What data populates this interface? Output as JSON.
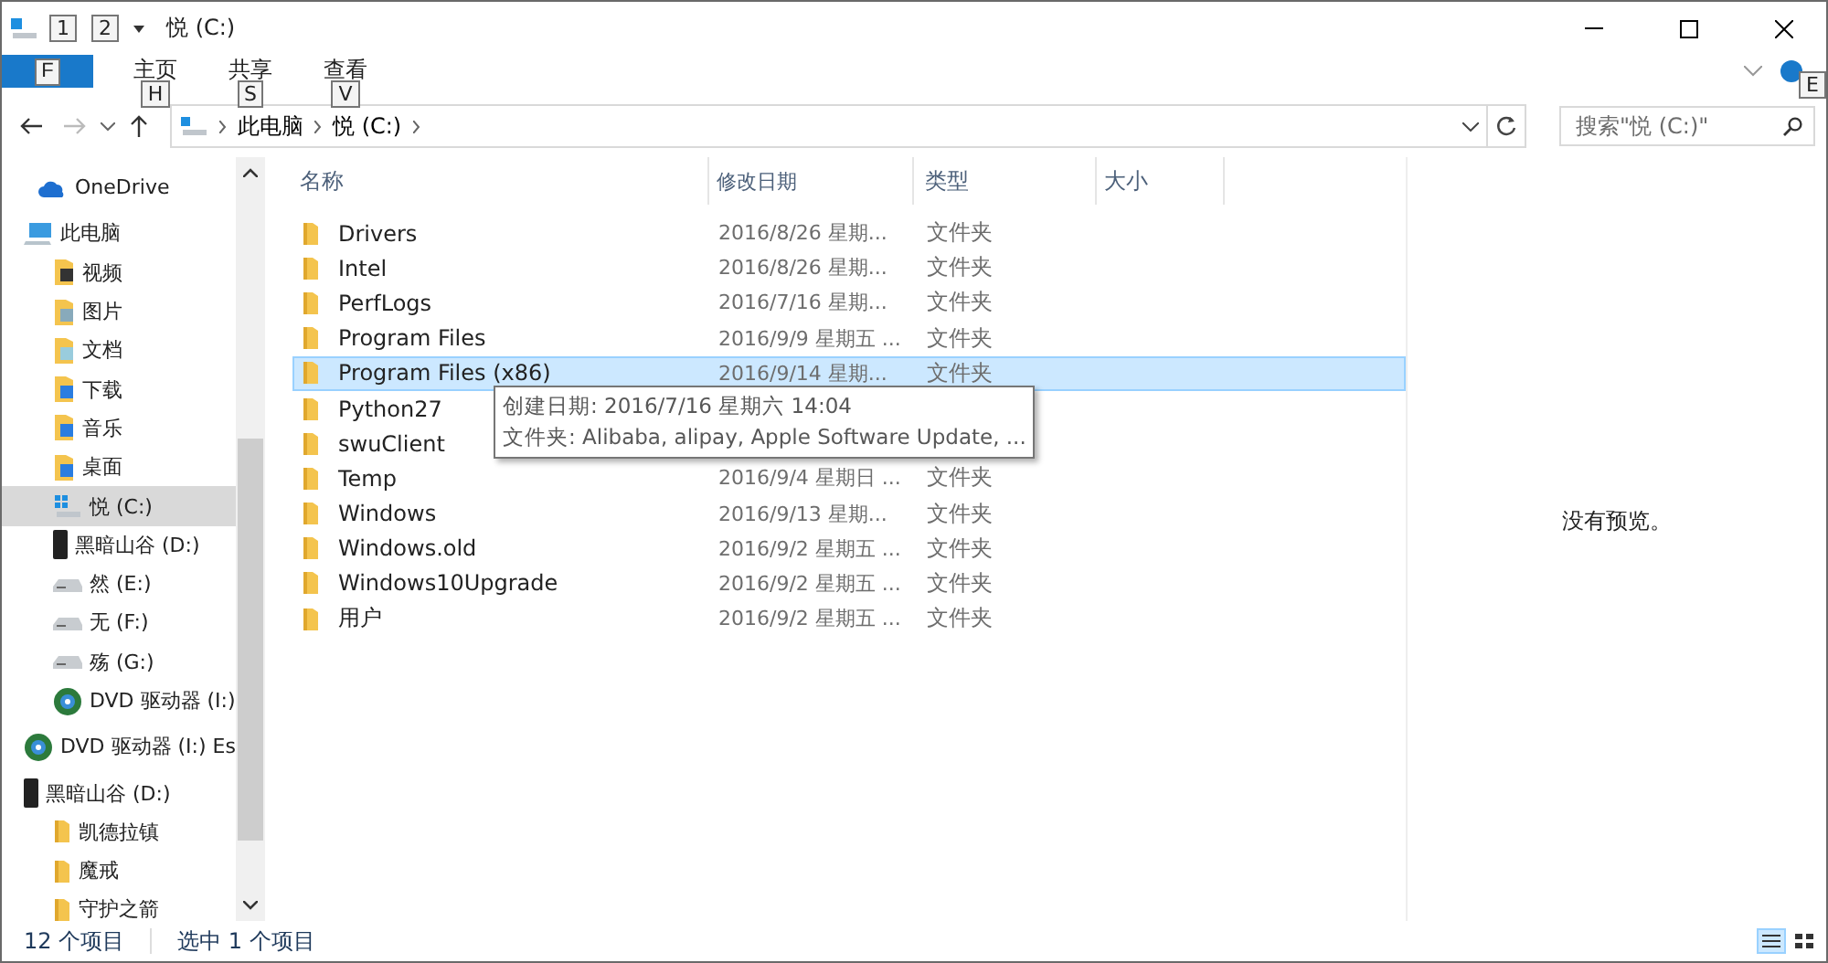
{
  "window": {
    "title": "悦 (C:)",
    "qat_keytips": [
      "1",
      "2"
    ]
  },
  "ribbon": {
    "file_keytip": "F",
    "tabs": [
      {
        "label": "主页",
        "keytip": "H"
      },
      {
        "label": "共享",
        "keytip": "S"
      },
      {
        "label": "查看",
        "keytip": "V"
      }
    ],
    "help_keytip": "E"
  },
  "address": {
    "crumbs": [
      "此电脑",
      "悦 (C:)"
    ],
    "search_placeholder": "搜索\"悦 (C:)\""
  },
  "sidebar": {
    "items": [
      {
        "label": "OneDrive",
        "kind": "cloud",
        "selected": false
      },
      {
        "label": "此电脑",
        "kind": "pc",
        "selected": false,
        "children": [
          {
            "label": "视频",
            "kind": "video",
            "selected": false
          },
          {
            "label": "图片",
            "kind": "pictures",
            "selected": false
          },
          {
            "label": "文档",
            "kind": "docs",
            "selected": false
          },
          {
            "label": "下载",
            "kind": "downloads",
            "selected": false
          },
          {
            "label": "音乐",
            "kind": "music",
            "selected": false
          },
          {
            "label": "桌面",
            "kind": "desktop",
            "selected": false
          },
          {
            "label": "悦 (C:)",
            "kind": "sysdrive",
            "selected": true
          },
          {
            "label": "黑暗山谷 (D:)",
            "kind": "phone",
            "selected": false
          },
          {
            "label": "然 (E:)",
            "kind": "drive",
            "selected": false
          },
          {
            "label": "无 (F:)",
            "kind": "drive",
            "selected": false
          },
          {
            "label": "殇 (G:)",
            "kind": "drive",
            "selected": false
          },
          {
            "label": "DVD 驱动器 (I:)",
            "kind": "dvd",
            "selected": false
          }
        ]
      },
      {
        "label": "DVD 驱动器 (I:) Es",
        "kind": "dvd",
        "selected": false
      },
      {
        "label": "黑暗山谷 (D:)",
        "kind": "phone",
        "selected": false,
        "children": [
          {
            "label": "凯德拉镇",
            "kind": "folder",
            "selected": false
          },
          {
            "label": "魔戒",
            "kind": "folder",
            "selected": false
          },
          {
            "label": "守护之箭",
            "kind": "folder",
            "selected": false
          }
        ]
      }
    ]
  },
  "table": {
    "columns": [
      "名称",
      "修改日期",
      "类型",
      "大小"
    ],
    "rows": [
      {
        "name": "Drivers",
        "date": "2016/8/26 星期...",
        "type": "文件夹",
        "selected": false
      },
      {
        "name": "Intel",
        "date": "2016/8/26 星期...",
        "type": "文件夹",
        "selected": false
      },
      {
        "name": "PerfLogs",
        "date": "2016/7/16 星期...",
        "type": "文件夹",
        "selected": false
      },
      {
        "name": "Program Files",
        "date": "2016/9/9 星期五 ...",
        "type": "文件夹",
        "selected": false
      },
      {
        "name": "Program Files (x86)",
        "date": "2016/9/14 星期...",
        "type": "文件夹",
        "selected": true
      },
      {
        "name": "Python27",
        "selected": false
      },
      {
        "name": "swuClient",
        "selected": false
      },
      {
        "name": "Temp",
        "date": "2016/9/4 星期日 ...",
        "type": "文件夹",
        "selected": false
      },
      {
        "name": "Windows",
        "date": "2016/9/13 星期...",
        "type": "文件夹",
        "selected": false
      },
      {
        "name": "Windows.old",
        "date": "2016/9/2 星期五 ...",
        "type": "文件夹",
        "selected": false
      },
      {
        "name": "Windows10Upgrade",
        "date": "2016/9/2 星期五 ...",
        "type": "文件夹",
        "selected": false
      },
      {
        "name": "用户",
        "date": "2016/9/2 星期五 ...",
        "type": "文件夹",
        "selected": false
      }
    ]
  },
  "tooltip": {
    "lines": [
      "创建日期: 2016/7/16 星期六 14:04",
      "文件夹: Alibaba, alipay, Apple Software Update, ..."
    ]
  },
  "preview": {
    "message": "没有预览。"
  },
  "status_bar": {
    "count": "12 个项目",
    "selection": "选中 1 个项目"
  }
}
